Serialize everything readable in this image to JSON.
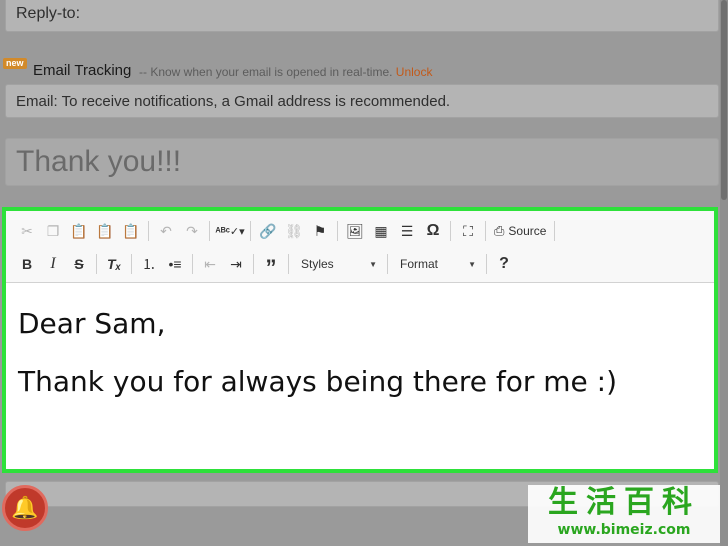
{
  "reply_to": {
    "label": "Reply-to:"
  },
  "tracking": {
    "badge": "new",
    "title": "Email Tracking",
    "description": "-- Know when your email is opened in real-time.",
    "unlock": "Unlock"
  },
  "email_note": {
    "value": "Email: To receive notifications, a Gmail address is recommended."
  },
  "subject": {
    "value": "Thank you!!!"
  },
  "toolbar": {
    "source_label": "Source",
    "styles_label": "Styles",
    "format_label": "Format",
    "help_label": "?"
  },
  "body": {
    "lines": [
      "Dear Sam,",
      "Thank you for always being there for me :)"
    ]
  },
  "watermark": {
    "cn": "生活百科",
    "url": "www.bimeiz.com"
  },
  "colors": {
    "editor_border": "#2ee13a",
    "unlock": "#c25a1a",
    "bell": "#c0392b"
  }
}
